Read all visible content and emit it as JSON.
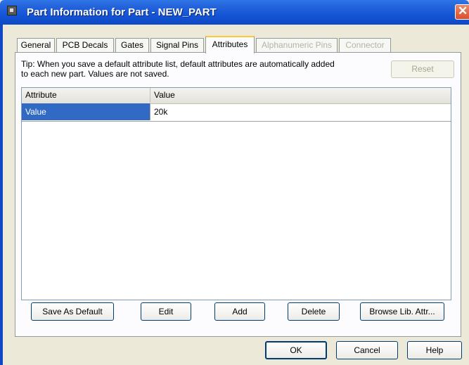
{
  "window": {
    "title": "Part Information for Part - NEW_PART"
  },
  "tabs": [
    {
      "label": "General"
    },
    {
      "label": "PCB Decals"
    },
    {
      "label": "Gates"
    },
    {
      "label": "Signal Pins"
    },
    {
      "label": "Attributes"
    },
    {
      "label": "Alphanumeric Pins"
    },
    {
      "label": "Connector"
    }
  ],
  "tip": "Tip: When you save a default attribute list, default attributes are automatically added to each new part. Values are not saved.",
  "buttons": {
    "reset": "Reset",
    "save_as_default": "Save As Default",
    "edit": "Edit",
    "add": "Add",
    "delete": "Delete",
    "browse": "Browse Lib. Attr...",
    "ok": "OK",
    "cancel": "Cancel",
    "help": "Help"
  },
  "grid": {
    "columns": [
      "Attribute",
      "Value"
    ],
    "rows": [
      {
        "attribute": "Value",
        "value": "20k"
      }
    ]
  },
  "colors": {
    "titlebar": "#0e48c4",
    "selection": "#316ac5",
    "active_tab_accent": "#ffc83c"
  }
}
